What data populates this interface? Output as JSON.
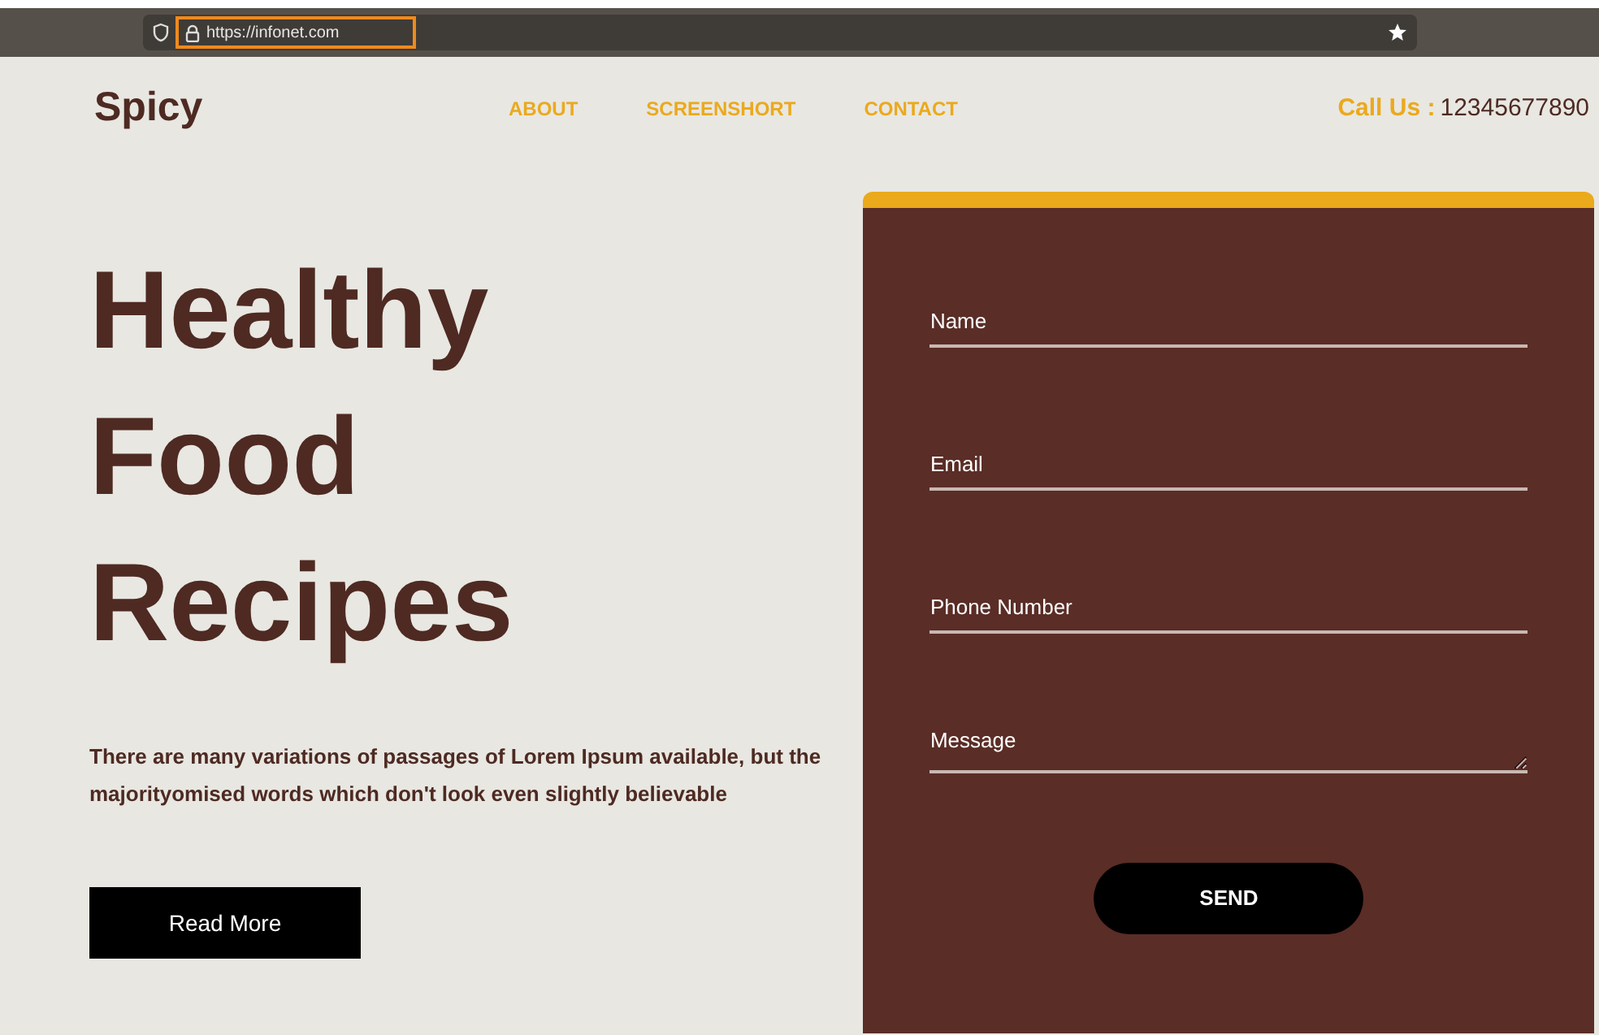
{
  "browser": {
    "url": "https://infonet.com"
  },
  "header": {
    "logo": "Spicy",
    "nav": [
      {
        "label": "ABOUT"
      },
      {
        "label": "SCREENSHORT"
      },
      {
        "label": "CONTACT"
      }
    ],
    "call_label": "Call Us :",
    "phone": "12345677890"
  },
  "hero": {
    "title_lines": [
      "Healthy",
      "Food",
      "Recipes"
    ],
    "text": "There are many variations of passages of Lorem Ipsum available, but the majorityomised words which don't look even slightly believable",
    "button": "Read More"
  },
  "form": {
    "fields": [
      {
        "kind": "input",
        "placeholder": "Name"
      },
      {
        "kind": "input",
        "placeholder": "Email"
      },
      {
        "kind": "input",
        "placeholder": "Phone Number"
      },
      {
        "kind": "textarea",
        "placeholder": "Message"
      }
    ],
    "button": "SEND"
  }
}
